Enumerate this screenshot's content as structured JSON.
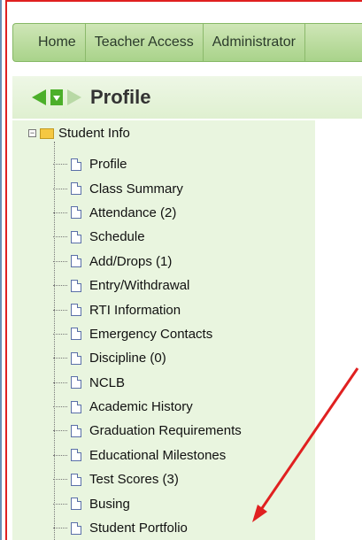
{
  "nav": {
    "items": [
      "Home",
      "Teacher Access",
      "Administrator"
    ]
  },
  "profile": {
    "title": "Profile"
  },
  "tree": {
    "root_label": "Student Info",
    "items": [
      "Profile",
      "Class Summary",
      "Attendance (2)",
      "Schedule",
      "Add/Drops (1)",
      "Entry/Withdrawal",
      "RTI Information",
      "Emergency Contacts",
      "Discipline (0)",
      "NCLB",
      "Academic History",
      "Graduation Requirements",
      "Educational Milestones",
      "Test Scores (3)",
      "Busing",
      "Student Portfolio"
    ]
  },
  "colors": {
    "nav_green": "#a9d38a",
    "tree_bg": "#e9f5df",
    "annotation_red": "#e02020",
    "arrow_green": "#4caf2a"
  },
  "icons": [
    "back-arrow-icon",
    "dropdown-icon",
    "forward-arrow-icon",
    "folder-icon",
    "document-icon",
    "collapse-icon"
  ]
}
